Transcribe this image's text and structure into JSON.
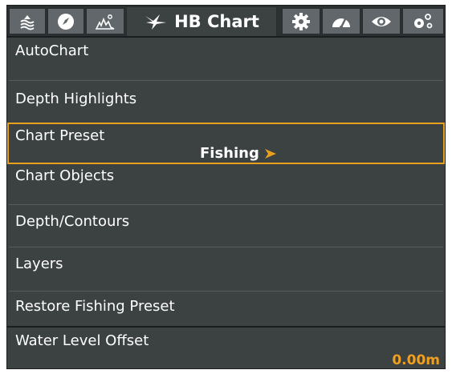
{
  "tabs": [
    {
      "icon": "navigation-menu-icon"
    },
    {
      "icon": "compass-icon"
    },
    {
      "icon": "sonar-icon"
    },
    {
      "icon": "humminbird-logo-icon",
      "label": "HB Chart",
      "active": true
    },
    {
      "icon": "gear-icon"
    },
    {
      "icon": "gauge-icon"
    },
    {
      "icon": "eye-icon"
    },
    {
      "icon": "network-icon"
    }
  ],
  "menu": {
    "autochart": "AutoChart",
    "depth_highlights": "Depth Highlights",
    "chart_preset": "Chart Preset",
    "chart_preset_value": "Fishing",
    "chart_objects": "Chart Objects",
    "depth_contours": "Depth/Contours",
    "layers": "Layers",
    "restore_fishing_preset": "Restore Fishing Preset",
    "water_level_offset": "Water Level Offset",
    "water_level_offset_value": "0.00m"
  },
  "colors": {
    "accent": "#e8a01e",
    "background": "#3c4142",
    "tab": "#61676a",
    "text": "#ffffff"
  }
}
